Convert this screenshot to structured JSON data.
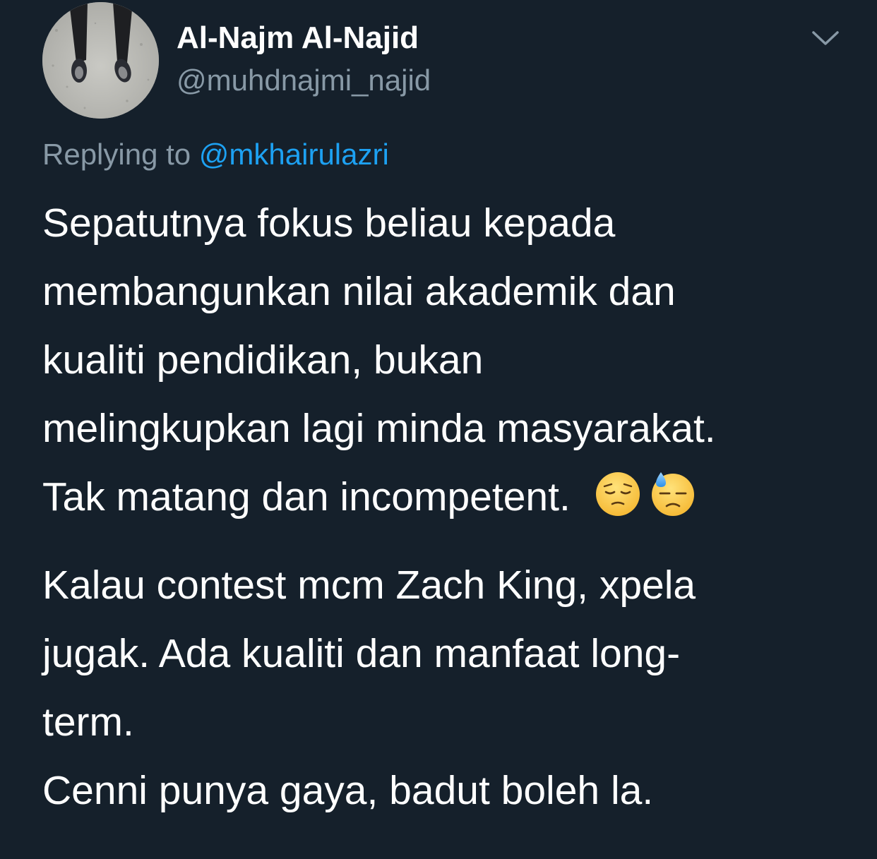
{
  "user": {
    "display_name": "Al-Najm Al-Najid",
    "handle": "@muhdnajmi_najid"
  },
  "reply": {
    "prefix": "Replying to ",
    "mention": "@mkhairulazri"
  },
  "body": {
    "paragraph1": [
      "Sepatutnya fokus beliau kepada",
      "membangunkan nilai akademik dan",
      "kualiti pendidikan, bukan",
      "melingkupkan lagi minda masyarakat.",
      "Tak matang dan incompetent."
    ],
    "paragraph1_emojis": [
      "pensive-face",
      "downcast-face-with-sweat"
    ],
    "paragraph2": [
      "Kalau contest mcm Zach King, xpela",
      "jugak. Ada kualiti dan manfaat long-",
      "term.",
      "Cenni punya gaya, badut boleh la."
    ]
  },
  "colors": {
    "background": "#15202b",
    "text_primary": "#ffffff",
    "text_secondary": "#8899a6",
    "link": "#1da1f2"
  },
  "icons": {
    "menu_caret": "chevron-down-icon"
  }
}
